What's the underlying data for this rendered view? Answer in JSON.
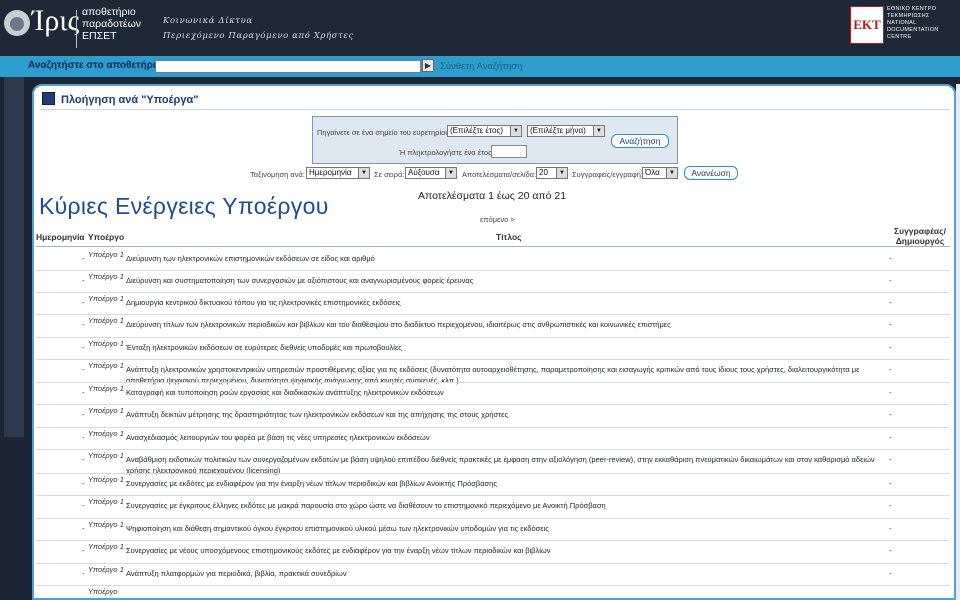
{
  "header": {
    "logo_name": "Ίρις",
    "logo_sub": "αποθετήριο\nπαραδοτέων\nΕΠΣΕΤ",
    "tagline_line1": "Κοινωνικά Δίκτυα",
    "tagline_line2": "Περιεχόμενο Παραγόμενο από Χρήστες",
    "ekt_logo": "ΕΚΤ",
    "ekt_text": "ΕΘΝΙΚΟ ΚΕΝΤΡΟ\nΤΕΚΜΗΡΙΩΣΗΣ\nNATIONAL\nDOCUMENTATION\nCENTRE"
  },
  "search": {
    "label": "Αναζητήστε στο αποθετήριο",
    "value": "",
    "go_icon": "play-arrow-icon",
    "advanced_label": "Σύνθετη Αναζήτηση"
  },
  "browse": {
    "title": "Πλοήγηση ανά \"Υποέργα\"",
    "jump_label": "Πηγαίνετε σε ένα σημείο του ευρετηρίου:",
    "year_select": "(Επιλέξτε έτος)",
    "month_select": "(Επιλέξτε μήνα)",
    "search_button": "Αναζήτηση",
    "type_year_label": "Ή πληκτρολογήστε ένα έτος:",
    "year_value": "",
    "sort_by_label": "Ταξινόμηση ανά:",
    "sort_by_value": "Ημερομηνία",
    "order_label": "Σε σειρά:",
    "order_value": "Αύξουσα",
    "per_page_label": "Αποτελέσματα/σελίδα:",
    "per_page_value": "20",
    "authors_label": "Συγγραφείς/εγγραφή:",
    "authors_value": "Όλα",
    "refresh_button": "Ανανέωση",
    "results_text": "Αποτελέσματα 1 έως 20 από 21",
    "next_link": "επόμενο >"
  },
  "overlay_title": "Κύριες Ενέργειες Υποέργου",
  "table": {
    "headers": {
      "date": "Ημερομηνία",
      "type": "Υποέργο",
      "title": "Τίτλος",
      "author": "Συγγραφέας/ Δημιουργός"
    },
    "rows": [
      {
        "date": "-",
        "type": "Υποέργο 1",
        "title": "Διεύρυνση των ηλεκτρονικών επιστημονικών εκδόσεων σε είδος και αριθμό",
        "author": "-"
      },
      {
        "date": "-",
        "type": "Υποέργο 1",
        "title": "Διεύρυνση και συστηματοποίηση των συνεργασιών με αξιόπιστους και αναγνωρισμένους φορείς έρευνας",
        "author": "-"
      },
      {
        "date": "-",
        "type": "Υποέργο 1",
        "title": "Δημιουργία κεντρικού δικτυακού τόπου για τις ηλεκτρονικές επιστημονικές εκδόσεις",
        "author": "-"
      },
      {
        "date": "-",
        "type": "Υποέργο 1",
        "title": "Διεύρυνση τίτλων των ηλεκτρονικών περιοδικών και βιβλίων και του διαθέσιμου στο διαδίκτυο περιεχομένου, ιδιαιτέρως στις ανθρωπιστικές και κοινωνικές επιστήμες",
        "author": "-"
      },
      {
        "date": "-",
        "type": "Υποέργο 1",
        "title": "Ένταξη ηλεκτρονικών εκδόσεων σε ευρύτερες διεθνείς υποδομές και πρωτοβουλίες",
        "author": "-"
      },
      {
        "date": "-",
        "type": "Υποέργο 1",
        "title": "Ανάπτυξη ηλεκτρονικών χρηστοκεντρικών υπηρεσιών προστιθέμενης αξίας για τις εκδόσεις (δυνατότητα αυτοαρχειοθέτησης, παραμετροποίησης και εισαγωγής κριτικών από τους ίδιους τους χρήστες, διαλειτουργικότητα με αποθετήρια ψηφιακού περιεχομένου, δυνατότητα ψηφιακής ανάγνωσης από κινητές συσκευές, κλπ.)",
        "author": "-"
      },
      {
        "date": "-",
        "type": "Υποέργο 1",
        "title": "Καταγραφή και τυποποίηση ροών εργασίας και διαδικασιών ανάπτυξης ηλεκτρονικών εκδόσεων",
        "author": "-"
      },
      {
        "date": "-",
        "type": "Υποέργο 1",
        "title": "Ανάπτυξη δεικτών μέτρησης της δραστηριότητας των ηλεκτρονικών εκδόσεων και της απήχησης της στους χρήστες",
        "author": "-"
      },
      {
        "date": "-",
        "type": "Υποέργο 1",
        "title": "Ανασχεδιασμός λειτουργιών του φορέα με βάση τις νέες υπηρεσίες ηλεκτρονικών εκδόσεων",
        "author": "-"
      },
      {
        "date": "-",
        "type": "Υποέργο 1",
        "title": "Αναβάθμιση εκδοτικών πολιτικών των συνεργαζομένων εκδοτών με βάση υψηλού επιπέδου διεθνείς πρακτικές με έμφαση στην αξιολόγηση (peer-review), στην εκκαθάριση πνευματικών δικαιωμάτων και στον καθορισμό αδειών χρήσης ηλεκτρονικού περιεχομένου (licensing)",
        "author": "-"
      },
      {
        "date": "-",
        "type": "Υποέργο 1",
        "title": "Συνεργασίες με εκδότες με ενδιαφέρον για την έναρξη νέων τίτλων περιοδικών και βιβλίων Ανοικτής Πρόσβασης",
        "author": "-"
      },
      {
        "date": "-",
        "type": "Υποέργο 1",
        "title": "Συνεργασίες με έγκριτους έλληνες εκδότες με μακρά παρουσία στο χώρο ώστε να διαθέσουν το επιστημονικό περιεχόμενο με Ανοικτή Πρόσβαση",
        "author": "-"
      },
      {
        "date": "-",
        "type": "Υποέργο 1",
        "title": "Ψηφιοποίηση και διάθεση σημαντικού όγκου έγκριτου επιστημονικού υλικού μέσω των ηλεκτρονικών υποδομών για τις εκδόσεις",
        "author": "-"
      },
      {
        "date": "-",
        "type": "Υποέργο 1",
        "title": "Συνεργασίες με νέους υποσχόμενους επιστημονικούς εκδότες με ενδιαφέρον για την έναρξη νέων τίτλων περιοδικών και βιβλίων",
        "author": "-"
      },
      {
        "date": "-",
        "type": "Υποέργο 1",
        "title": "Ανάπτυξη πλατφορμών για περιοδικά, βιβλία, πρακτικά συνεδρίων",
        "author": "-"
      },
      {
        "date": "",
        "type": "Υποέργο",
        "title": "",
        "author": ""
      }
    ]
  }
}
